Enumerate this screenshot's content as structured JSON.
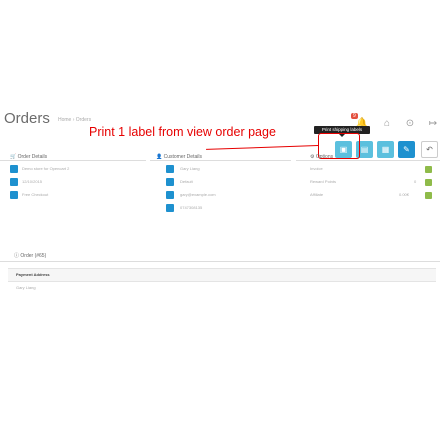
{
  "header": {
    "notification_count": "9",
    "title": "Orders",
    "breadcrumb": [
      "Home",
      "Orders"
    ],
    "annotation": "Print 1 label  from view order page",
    "tooltip": "Print shipping labels"
  },
  "panels": {
    "order_details": {
      "title": "Order Details",
      "rows": [
        "Demo store for Opencart 2",
        "12/10/2015",
        "Free Checkout"
      ]
    },
    "customer_details": {
      "title": "Customer Details",
      "rows": [
        "Gary Liang",
        "Default",
        "gary@example.com",
        "0747308135"
      ]
    },
    "options": {
      "title": "Options",
      "rows": [
        {
          "label": "Invoice",
          "value": ""
        },
        {
          "label": "Reward Points",
          "value": "0"
        },
        {
          "label": "Affiliate",
          "value": "0.00€"
        }
      ]
    }
  },
  "order": {
    "title": "Order (#65)",
    "table_header": "Payment Address",
    "table_cell": "Gary Liang"
  }
}
